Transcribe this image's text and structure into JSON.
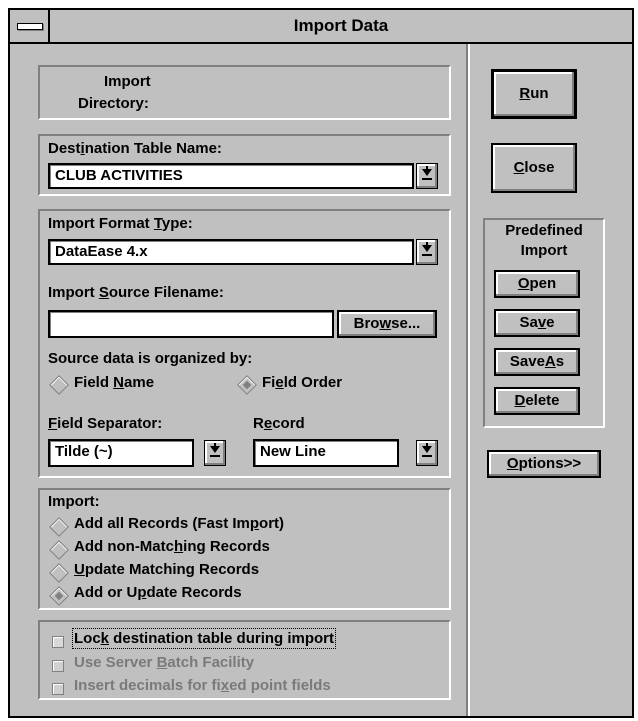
{
  "window": {
    "title": "Import Data"
  },
  "import_directory": {
    "label_line1": "Import",
    "label_line2": "Directory:"
  },
  "destination": {
    "label_pre": "Dest",
    "label_u": "i",
    "label_post": "nation Table Name:",
    "value": "CLUB ACTIVITIES"
  },
  "format": {
    "label_pre": "Import Format ",
    "label_u": "T",
    "label_post": "ype:",
    "value": "DataEase 4.x"
  },
  "source": {
    "label_pre": "Import ",
    "label_u": "S",
    "label_post": "ource Filename:",
    "value": "",
    "browse_pre": "Bro",
    "browse_u": "w",
    "browse_post": "se..."
  },
  "organized": {
    "label": "Source data is organized by:",
    "field_name_pre": "Field ",
    "field_name_u": "N",
    "field_name_post": "ame",
    "field_order_pre": "Fi",
    "field_order_u": "e",
    "field_order_post": "ld Order",
    "selected": "field_order"
  },
  "separator": {
    "label_u": "F",
    "label_post": "ield Separator:",
    "value": "Tilde (~)"
  },
  "record": {
    "label_pre": "R",
    "label_u": "e",
    "label_post": "cord",
    "value": "New Line"
  },
  "import_mode": {
    "label": "Import:",
    "options": [
      {
        "pre": "Add all Records (Fast Im",
        "u": "p",
        "post": "ort)"
      },
      {
        "pre": "Add non-Matc",
        "u": "h",
        "post": "ing Records"
      },
      {
        "pre": "",
        "u": "U",
        "post": "pdate Matching Records"
      },
      {
        "pre": "Add or U",
        "u": "p",
        "post": "date Records"
      }
    ],
    "selected_index": 3
  },
  "checkboxes": [
    {
      "pre": "Loc",
      "u": "k",
      "post": " destination table during import",
      "enabled": true
    },
    {
      "pre": "Use Server ",
      "u": "B",
      "post": "atch Facility",
      "enabled": false
    },
    {
      "pre": "Insert decimals for fi",
      "u": "x",
      "post": "ed point fields",
      "enabled": false
    }
  ],
  "buttons": {
    "run_u": "R",
    "run_post": "un",
    "close_u": "C",
    "close_post": "lose",
    "predefined_line1": "Predefined",
    "predefined_line2": "Import",
    "open_u": "O",
    "open_post": "pen",
    "save_pre": "Sa",
    "save_u": "v",
    "save_post": "e",
    "saveas_pre": "Save",
    "saveas_u": "A",
    "saveas_post": "s",
    "delete_u": "D",
    "delete_post": "elete",
    "options_pre": "O",
    "options_u": "p",
    "options_post": "tions>>"
  }
}
